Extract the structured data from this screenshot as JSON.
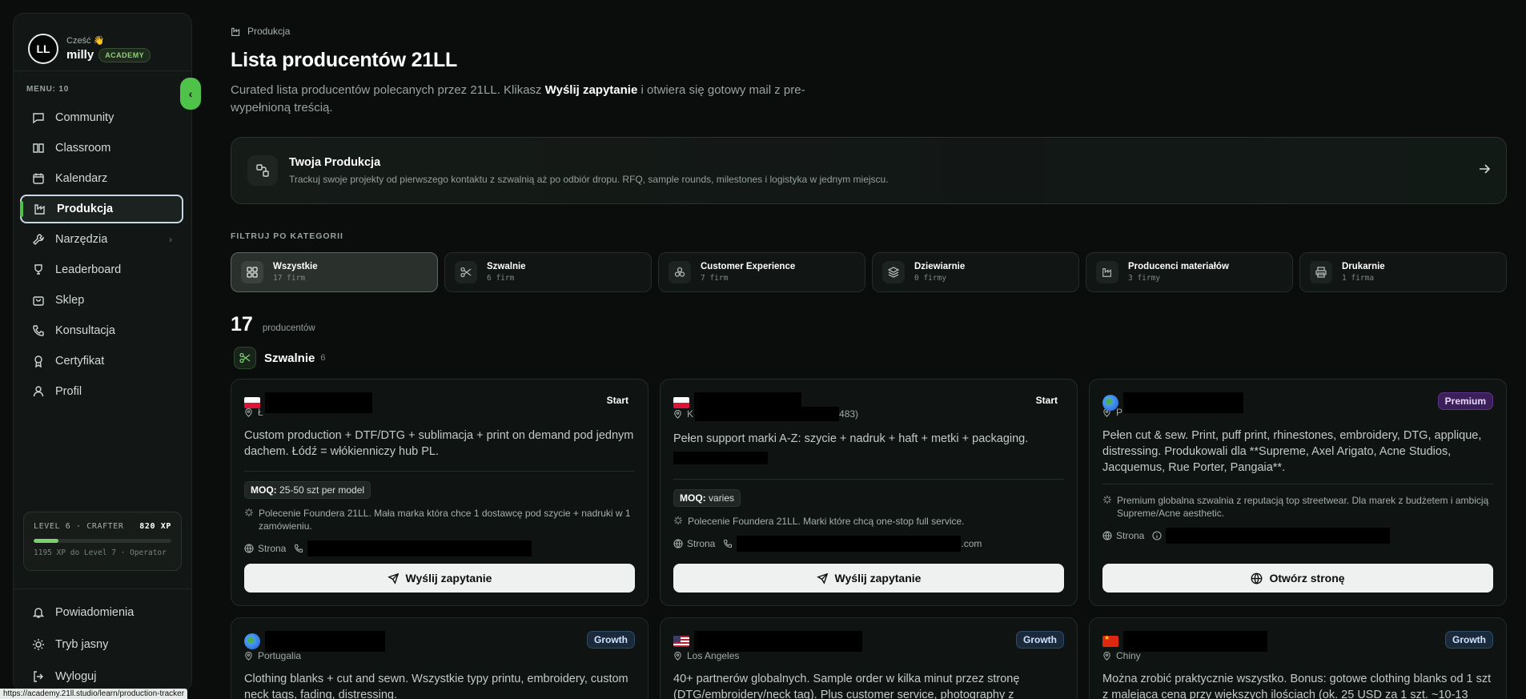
{
  "user": {
    "initials": "LL",
    "greeting": "Cześć 👋",
    "name": "milly",
    "badge": "ACADEMY"
  },
  "menu": {
    "label": "MENU: 10",
    "items": [
      {
        "label": "Community"
      },
      {
        "label": "Classroom"
      },
      {
        "label": "Kalendarz"
      },
      {
        "label": "Produkcja"
      },
      {
        "label": "Narzędzia"
      },
      {
        "label": "Leaderboard"
      },
      {
        "label": "Sklep"
      },
      {
        "label": "Konsultacja"
      },
      {
        "label": "Certyfikat"
      },
      {
        "label": "Profil"
      }
    ],
    "active": "Produkcja"
  },
  "level": {
    "title": "LEVEL 6 · CRAFTER",
    "xp": "820 XP",
    "progress": 0.18,
    "sub": "1195 XP do Level 7 · Operator"
  },
  "bottom_menu": [
    {
      "label": "Powiadomienia"
    },
    {
      "label": "Tryb jasny"
    },
    {
      "label": "Wyloguj"
    }
  ],
  "status_url": "https://academy.21ll.studio/learn/production-tracker",
  "breadcrumb": "Produkcja",
  "page": {
    "title": "Lista producentów 21LL",
    "desc_pre": "Curated lista producentów polecanych przez 21LL. Klikasz ",
    "desc_bold": "Wyślij zapytanie",
    "desc_post": " i otwiera się gotowy mail z pre-wypełnioną treścią."
  },
  "production_card": {
    "title": "Twoja Produkcja",
    "subtitle": "Trackuj swoje projekty od pierwszego kontaktu z szwalnią aż po odbiór dropu. RFQ, sample rounds, milestones i logistyka w jednym miejscu."
  },
  "filter_label": "FILTRUJ PO KATEGORII",
  "categories": [
    {
      "name": "Wszystkie",
      "count": "17 firm"
    },
    {
      "name": "Szwalnie",
      "count": "6 firm"
    },
    {
      "name": "Customer Experience",
      "count": "7 firm"
    },
    {
      "name": "Dziewiarnie",
      "count": "0 firmy"
    },
    {
      "name": "Producenci materiałów",
      "count": "3 firmy"
    },
    {
      "name": "Drukarnie",
      "count": "1 firma"
    }
  ],
  "total": {
    "count": "17",
    "label": "producentów"
  },
  "section": {
    "name": "Szwalnie",
    "count": "6"
  },
  "cards": [
    {
      "tier": "Start",
      "location": "Ł",
      "desc": "Custom production + DTF/DTG + sublimacja + print on demand pod jednym dachem. Łódź = włókienniczy hub PL.",
      "moq_label": "MOQ:",
      "moq_value": "25-50 szt per model",
      "note": "Polecenie Foundera 21LL. Mała marka która chce 1 dostawcę pod szycie + nadruki w 1 zamówieniu.",
      "link": "Strona",
      "link_tail": "",
      "button": "Wyślij zapytanie"
    },
    {
      "tier": "Start",
      "location": "K",
      "location_tail": "483)",
      "desc": "Pełen support marki A-Z: szycie + nadruk + haft + metki + packaging.",
      "moq_label": "MOQ:",
      "moq_value": "varies",
      "note": "Polecenie Foundera 21LL. Marki które chcą one-stop full service.",
      "link": "Strona",
      "link_tail": ".com",
      "button": "Wyślij zapytanie"
    },
    {
      "tier": "Premium",
      "location": "P",
      "desc": "Pełen cut & sew. Print, puff print, rhinestones, embroidery, DTG, applique, distressing. Produkowali dla **Supreme, Axel Arigato, Acne Studios, Jacquemus, Rue Porter, Pangaia**.",
      "note": "Premium globalna szwalnia z reputacją top streetwear. Dla marek z budżetem i ambicją Supreme/Acne aesthetic.",
      "link": "Strona",
      "link_tail": "",
      "button": "Otwórz stronę"
    },
    {
      "tier": "Growth",
      "location": "Portugalia",
      "desc": "Clothing blanks + cut and sewn. Wszystkie typy printu, embroidery, custom neck tags, fading, distressing."
    },
    {
      "tier": "Growth",
      "location": "Los Angeles",
      "desc": "40+ partnerów globalnych. Sample order w kilka minut przez stronę (DTG/embroidery/neck tag). Plus customer service, photography z"
    },
    {
      "tier": "Growth",
      "location": "Chiny",
      "desc": "Można zrobić praktycznie wszystko. Bonus: gotowe clothing blanks od 1 szt z malejąca ceną przy większych ilościach (ok. 25 USD za 1 szt. ~10-13"
    }
  ],
  "colors": {
    "accent": "#4fc24a",
    "background": "#0a0d0b",
    "premium": "#3a1f59",
    "growth": "#1a2a3a"
  }
}
